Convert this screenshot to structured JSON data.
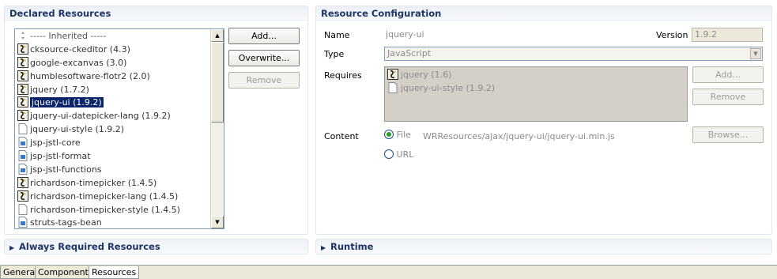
{
  "declared": {
    "title": "Declared Resources",
    "items": [
      {
        "label": "----- Inherited -----",
        "icon": "inherited-icon"
      },
      {
        "label": "cksource-ckeditor (4.3)",
        "icon": "javascript-icon"
      },
      {
        "label": "google-excanvas (3.0)",
        "icon": "javascript-icon"
      },
      {
        "label": "humblesoftware-flotr2 (2.0)",
        "icon": "javascript-icon"
      },
      {
        "label": "jquery (1.7.2)",
        "icon": "javascript-icon"
      },
      {
        "label": "jquery-ui (1.9.2)",
        "icon": "javascript-icon",
        "selected": true
      },
      {
        "label": "jquery-ui-datepicker-lang (1.9.2)",
        "icon": "javascript-icon"
      },
      {
        "label": "jquery-ui-style (1.9.2)",
        "icon": "file-icon"
      },
      {
        "label": "jsp-jstl-core",
        "icon": "jsp-icon"
      },
      {
        "label": "jsp-jstl-format",
        "icon": "jsp-icon"
      },
      {
        "label": "jsp-jstl-functions",
        "icon": "jsp-icon"
      },
      {
        "label": "richardson-timepicker (1.4.5)",
        "icon": "javascript-icon"
      },
      {
        "label": "richardson-timepicker-lang (1.4.5)",
        "icon": "javascript-icon"
      },
      {
        "label": "richardson-timepicker-style (1.4.5)",
        "icon": "file-icon"
      },
      {
        "label": "struts-tags-bean",
        "icon": "jsp-icon"
      }
    ],
    "buttons": {
      "add": "Add...",
      "overwrite": "Overwrite...",
      "remove": "Remove"
    }
  },
  "config": {
    "title": "Resource Configuration",
    "name_label": "Name",
    "name_value": "jquery-ui",
    "version_label": "Version",
    "version_value": "1.9.2",
    "type_label": "Type",
    "type_value": "JavaScript",
    "requires_label": "Requires",
    "requires": [
      {
        "label": "jquery (1.6)",
        "icon": "javascript-icon"
      },
      {
        "label": "jquery-ui-style (1.9.2)",
        "icon": "file-icon"
      }
    ],
    "req_add": "Add...",
    "req_remove": "Remove",
    "content_label": "Content",
    "file_label": "File",
    "file_path": "WRResources/ajax/jquery-ui/jquery-ui.min.js",
    "browse": "Browse...",
    "url_label": "URL",
    "selected_content": "File"
  },
  "collapsed": {
    "always_required": "Always Required Resources",
    "runtime": "Runtime"
  },
  "tabs": [
    "General",
    "Components",
    "Resources"
  ],
  "active_tab": "Resources"
}
